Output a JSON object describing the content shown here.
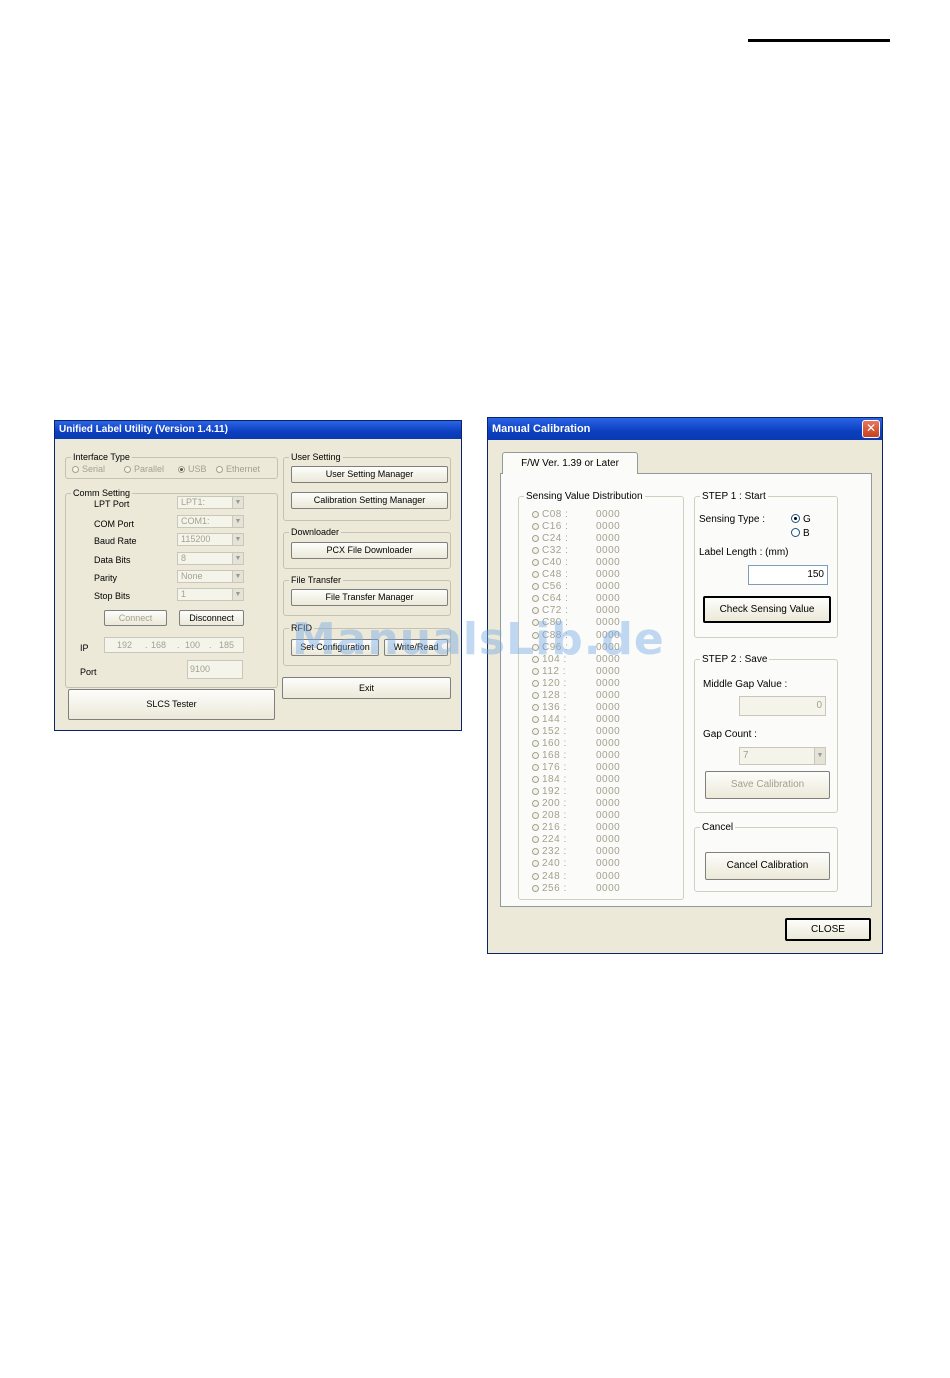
{
  "left_window": {
    "title": "Unified Label Utility  (Version 1.4.11)",
    "interface_type": {
      "title": "Interface Type",
      "options": [
        {
          "label": "Serial",
          "selected": false
        },
        {
          "label": "Parallel",
          "selected": false
        },
        {
          "label": "USB",
          "selected": true
        },
        {
          "label": "Ethernet",
          "selected": false
        }
      ]
    },
    "comm_setting": {
      "title": "Comm Setting",
      "lpt_port": {
        "label": "LPT Port",
        "value": "LPT1:"
      },
      "com_port": {
        "label": "COM Port",
        "value": "COM1:"
      },
      "baud_rate": {
        "label": "Baud Rate",
        "value": "115200"
      },
      "data_bits": {
        "label": "Data Bits",
        "value": "8"
      },
      "parity": {
        "label": "Parity",
        "value": "None"
      },
      "stop_bits": {
        "label": "Stop Bits",
        "value": "1"
      },
      "connect_label": "Connect",
      "disconnect_label": "Disconnect",
      "ip": {
        "label": "IP",
        "octets": [
          "192",
          "168",
          "100",
          "185"
        ]
      },
      "port": {
        "label": "Port",
        "value": "9100"
      }
    },
    "slcs_tester_label": "SLCS Tester",
    "user_setting": {
      "title": "User Setting",
      "user_setting_manager": "User Setting Manager",
      "calibration_setting_manager": "Calibration Setting Manager"
    },
    "downloader": {
      "title": "Downloader",
      "pcx_file_downloader": "PCX File Downloader"
    },
    "file_transfer": {
      "title": "File Transfer",
      "file_transfer_manager": "File Transfer Manager"
    },
    "rfid": {
      "title": "RFID",
      "set_configuration": "Set Configuration",
      "write_read": "Write/Read"
    },
    "exit_label": "Exit"
  },
  "right_window": {
    "title": "Manual Calibration",
    "close_icon_glyph": "✕",
    "tab_label": "F/W Ver. 1.39 or Later",
    "sensing_distribution": {
      "title": "Sensing Value Distribution",
      "rows": [
        {
          "key": "C08 :",
          "value": "0000"
        },
        {
          "key": "C16 :",
          "value": "0000"
        },
        {
          "key": "C24 :",
          "value": "0000"
        },
        {
          "key": "C32 :",
          "value": "0000"
        },
        {
          "key": "C40 :",
          "value": "0000"
        },
        {
          "key": "C48 :",
          "value": "0000"
        },
        {
          "key": "C56 :",
          "value": "0000"
        },
        {
          "key": "C64 :",
          "value": "0000"
        },
        {
          "key": "C72 :",
          "value": "0000"
        },
        {
          "key": "C80 :",
          "value": "0000"
        },
        {
          "key": "C88 :",
          "value": "0000"
        },
        {
          "key": "C96 :",
          "value": "0000"
        },
        {
          "key": "104 :",
          "value": "0000"
        },
        {
          "key": "112 :",
          "value": "0000"
        },
        {
          "key": "120 :",
          "value": "0000"
        },
        {
          "key": "128 :",
          "value": "0000"
        },
        {
          "key": "136 :",
          "value": "0000"
        },
        {
          "key": "144 :",
          "value": "0000"
        },
        {
          "key": "152 :",
          "value": "0000"
        },
        {
          "key": "160 :",
          "value": "0000"
        },
        {
          "key": "168 :",
          "value": "0000"
        },
        {
          "key": "176 :",
          "value": "0000"
        },
        {
          "key": "184 :",
          "value": "0000"
        },
        {
          "key": "192 :",
          "value": "0000"
        },
        {
          "key": "200 :",
          "value": "0000"
        },
        {
          "key": "208 :",
          "value": "0000"
        },
        {
          "key": "216 :",
          "value": "0000"
        },
        {
          "key": "224 :",
          "value": "0000"
        },
        {
          "key": "232 :",
          "value": "0000"
        },
        {
          "key": "240 :",
          "value": "0000"
        },
        {
          "key": "248 :",
          "value": "0000"
        },
        {
          "key": "256 :",
          "value": "0000"
        }
      ]
    },
    "step1": {
      "title": "STEP 1 : Start",
      "sensing_type_label": "Sensing Type :",
      "options": [
        {
          "label": "G",
          "selected": true
        },
        {
          "label": "B",
          "selected": false
        }
      ],
      "label_length_label": "Label Length : (mm)",
      "label_length_value": "150",
      "check_sensing_value": "Check Sensing Value"
    },
    "step2": {
      "title": "STEP 2 : Save",
      "middle_gap_label": "Middle Gap Value :",
      "middle_gap_value": "0",
      "gap_count_label": "Gap Count :",
      "gap_count_value": "7",
      "save_calibration": "Save Calibration"
    },
    "cancel": {
      "title": "Cancel",
      "cancel_calibration": "Cancel Calibration"
    },
    "close_label": "CLOSE"
  },
  "watermark": "ManualsLib.de"
}
